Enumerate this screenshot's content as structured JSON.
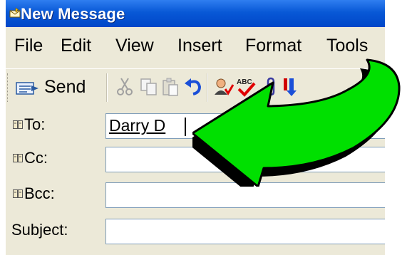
{
  "window": {
    "title": "New Message"
  },
  "menu": [
    "File",
    "Edit",
    "View",
    "Insert",
    "Format",
    "Tools"
  ],
  "toolbar": {
    "send_label": "Send",
    "buttons": [
      "cut-icon",
      "copy-icon",
      "paste-icon",
      "undo-icon",
      "check-names-icon",
      "spelling-icon",
      "attach-icon",
      "priority-icon"
    ]
  },
  "fields": {
    "to": {
      "label": "To:",
      "value": "Darry D"
    },
    "cc": {
      "label": "Cc:",
      "value": ""
    },
    "bcc": {
      "label": "Bcc:",
      "value": ""
    },
    "subject": {
      "label": "Subject:",
      "value": ""
    }
  },
  "annotation": {
    "icon": "curved-arrow-icon",
    "color": "#00e000"
  }
}
